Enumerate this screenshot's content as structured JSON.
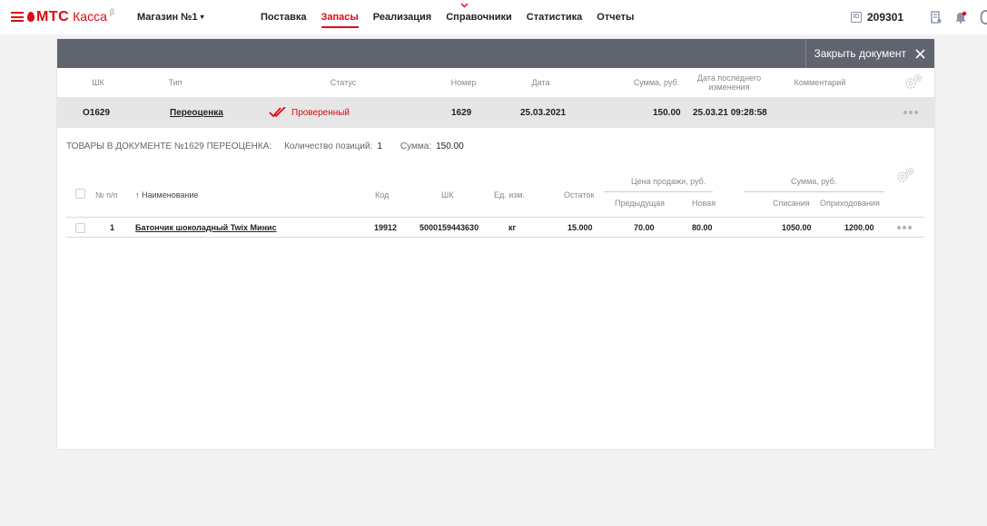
{
  "brand": {
    "mts": "МТС",
    "kassa": "Касса",
    "beta": "β"
  },
  "store": {
    "name": "Магазин №1",
    "caret": "▾"
  },
  "nav": [
    {
      "label": "Поставка",
      "active": false
    },
    {
      "label": "Запасы",
      "active": true
    },
    {
      "label": "Реализация",
      "active": false
    },
    {
      "label": "Справочники",
      "active": false
    },
    {
      "label": "Статистика",
      "active": false
    },
    {
      "label": "Отчеты",
      "active": false
    }
  ],
  "account": {
    "id_badge": "ID",
    "id": "209301"
  },
  "colors": {
    "accent": "#e30611",
    "header_dark": "#60646e",
    "row_highlight": "#e6e6e6"
  },
  "document_bar": {
    "close_label": "Закрыть документ"
  },
  "doc_table": {
    "headers": {
      "barcode": "ШК",
      "type": "Тип",
      "status": "Статус",
      "number": "Номер",
      "date": "Дата",
      "sum": "Сумма, руб.",
      "last_changed_1": "Дата последнего",
      "last_changed_2": "изменения",
      "comment": "Комментарий"
    },
    "row": {
      "barcode": "O1629",
      "type": "Переоценка",
      "status": "Проверенный",
      "number": "1629",
      "date": "25.03.2021",
      "sum": "150.00",
      "last_changed": "25.03.21 09:28:58",
      "comment": ""
    }
  },
  "goods": {
    "title": "ТОВАРЫ В ДОКУМЕНТЕ №1629 ПЕРЕОЦЕНКА:",
    "count_label": "Количество позиций:",
    "count_value": "1",
    "sum_label": "Сумма:",
    "sum_value": "150.00",
    "headers": {
      "num": "№ п/п",
      "name": "↑ Наименование",
      "code": "Код",
      "barcode": "ШК",
      "unit": "Ед. изм.",
      "stock": "Остаток",
      "price_group": "Цена продажи, руб.",
      "price_prev": "Предыдущая",
      "price_new": "Новая",
      "sum_group": "Сумма, руб.",
      "sum_writeoff": "Списания",
      "sum_income": "Оприходования"
    },
    "rows": [
      {
        "num": "1",
        "name": "Батончик шоколадный Twix Минис",
        "code": "19912",
        "barcode": "5000159443630",
        "unit": "кг",
        "stock": "15.000",
        "price_prev": "70.00",
        "price_new": "80.00",
        "sum_writeoff": "1050.00",
        "sum_income": "1200.00"
      }
    ]
  }
}
